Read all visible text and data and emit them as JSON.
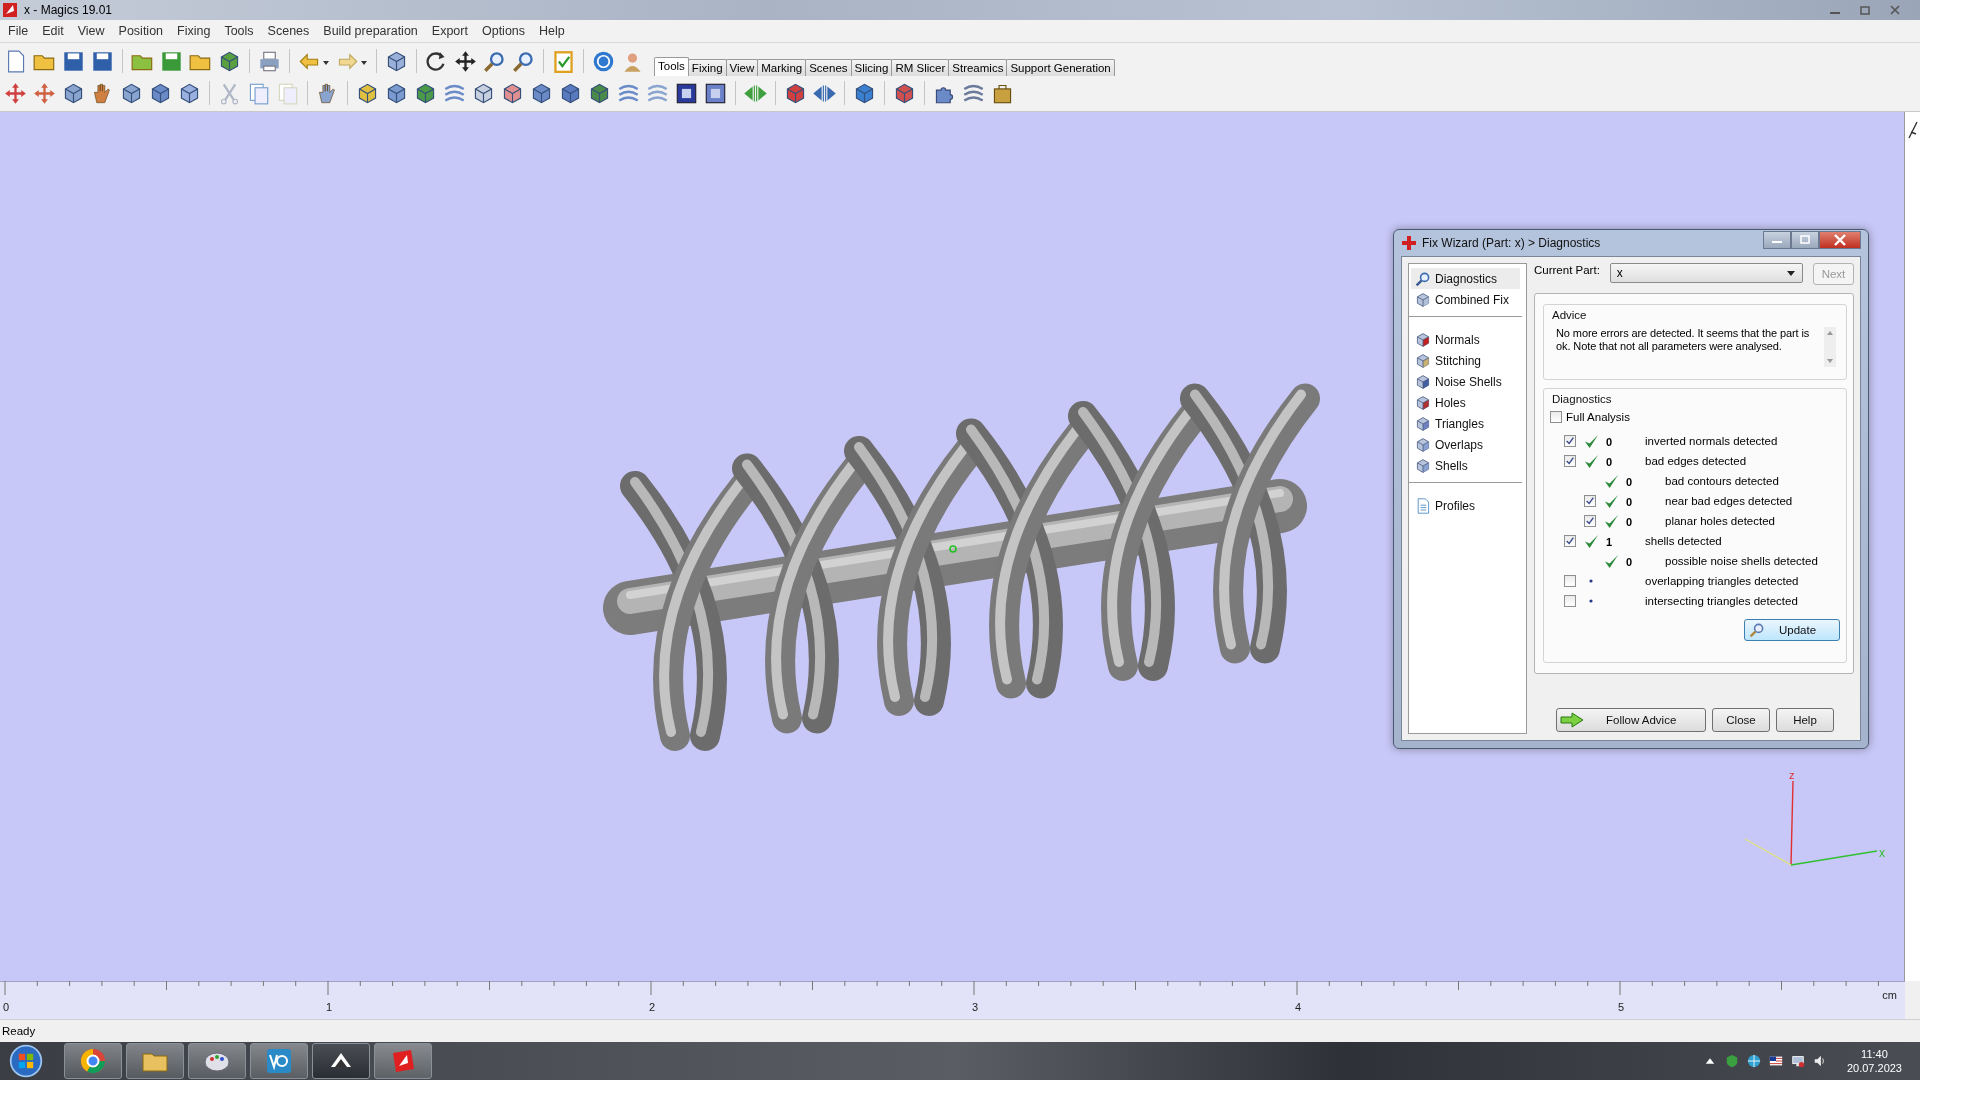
{
  "window": {
    "title": "x - Magics 19.01"
  },
  "menu": [
    "File",
    "Edit",
    "View",
    "Position",
    "Fixing",
    "Tools",
    "Scenes",
    "Build preparation",
    "Export",
    "Options",
    "Help"
  ],
  "tabs": [
    {
      "label": "Tools",
      "selected": true
    },
    {
      "label": "Fixing",
      "selected": false
    },
    {
      "label": "View",
      "selected": false
    },
    {
      "label": "Marking",
      "selected": false
    },
    {
      "label": "Scenes",
      "selected": false
    },
    {
      "label": "Slicing",
      "selected": false
    },
    {
      "label": "RM Slicer",
      "selected": false
    },
    {
      "label": "Streamics",
      "selected": false
    },
    {
      "label": "Support Generation",
      "selected": false
    }
  ],
  "fix_wizard": {
    "title": "Fix Wizard (Part: x) > Diagnostics",
    "nav_groups": [
      [
        {
          "label": "Diagnostics",
          "selected": true
        },
        {
          "label": "Combined Fix",
          "selected": false
        }
      ],
      [
        {
          "label": "Normals",
          "selected": false
        },
        {
          "label": "Stitching",
          "selected": false
        },
        {
          "label": "Noise Shells",
          "selected": false
        },
        {
          "label": "Holes",
          "selected": false
        },
        {
          "label": "Triangles",
          "selected": false
        },
        {
          "label": "Overlaps",
          "selected": false
        },
        {
          "label": "Shells",
          "selected": false
        }
      ],
      [
        {
          "label": "Profiles",
          "selected": false
        }
      ]
    ],
    "current_part": {
      "label": "Current Part:",
      "value": "x"
    },
    "next_button": {
      "label": "Next",
      "disabled": true
    },
    "advice": {
      "title": "Advice",
      "text": "No more errors are detected. It seems that the part is ok. Note that not all parameters were analysed."
    },
    "diagnostics": {
      "title": "Diagnostics",
      "full_analysis": {
        "label": "Full Analysis",
        "checked": false
      },
      "rows": [
        {
          "kind": "check",
          "checked": true,
          "passed": true,
          "count": "0",
          "label": "inverted normals detected"
        },
        {
          "kind": "check",
          "checked": true,
          "passed": true,
          "count": "0",
          "label": "bad edges detected",
          "children": [
            {
              "kind": "info",
              "passed": true,
              "count": "0",
              "label": "bad contours detected"
            },
            {
              "kind": "check",
              "checked": true,
              "passed": true,
              "count": "0",
              "label": "near bad edges detected"
            },
            {
              "kind": "check",
              "checked": true,
              "passed": true,
              "count": "0",
              "label": "planar holes detected"
            }
          ]
        },
        {
          "kind": "check",
          "checked": true,
          "passed": true,
          "count": "1",
          "label": "shells detected",
          "children": [
            {
              "kind": "info",
              "passed": true,
              "count": "0",
              "label": "possible noise shells detected"
            }
          ]
        },
        {
          "kind": "check",
          "checked": false,
          "passed": false,
          "label": "overlapping triangles detected"
        },
        {
          "kind": "check",
          "checked": false,
          "passed": false,
          "label": "intersecting triangles detected"
        }
      ],
      "update_button": "Update"
    },
    "buttons": [
      "Follow Advice",
      "Close",
      "Help"
    ]
  },
  "axis_triad": {
    "z_label": "z",
    "x_label": "x"
  },
  "ruler": {
    "labels": [
      "0",
      "1",
      "2",
      "3",
      "4",
      "5"
    ],
    "unit": "cm"
  },
  "status_bar": "Ready",
  "taskbar": {
    "time": "11:40",
    "date": "20.07.2023"
  }
}
